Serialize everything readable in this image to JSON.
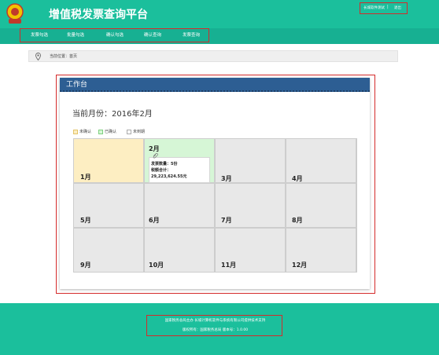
{
  "header": {
    "title": "增值税发票查询平台",
    "user_name": "长城软件测试",
    "logout_label": "退出",
    "separator": "|"
  },
  "nav": {
    "items": [
      {
        "label": "发票勾选"
      },
      {
        "label": "批量勾选"
      },
      {
        "label": "确认勾选"
      },
      {
        "label": "确认查询"
      },
      {
        "label": "发票查询"
      }
    ]
  },
  "breadcrumb": {
    "label": "当前位置：首页"
  },
  "panel": {
    "title": "工作台",
    "current_month": "当前月份：2016年2月"
  },
  "legend": {
    "items": [
      {
        "label": "未确认",
        "color": "#fdeec2",
        "border": "#e3c46a"
      },
      {
        "label": "已确认",
        "color": "#d6f6d6",
        "border": "#7fcf7f"
      },
      {
        "label": "未到期",
        "color": "#ffffff",
        "border": "#aaaaaa"
      }
    ]
  },
  "calendar": {
    "months": [
      "1月",
      "2月",
      "3月",
      "4月",
      "5月",
      "6月",
      "7月",
      "8月",
      "9月",
      "10月",
      "11月",
      "12月"
    ],
    "feb_detail": {
      "count_line": "发票数量：5份",
      "total_line": "税额合计：",
      "total_value": "29,223,624.55元"
    }
  },
  "footer": {
    "line1": "国家税务总局主办 长城计算机软件与系统有限公司提供技术支持",
    "line2": "版权所有：国家税务总局 版本号：1.0.00"
  },
  "colors": {
    "brand": "#1bbf9c",
    "panel_header": "#2d5e93",
    "highlight_outline": "#d42b2b"
  }
}
